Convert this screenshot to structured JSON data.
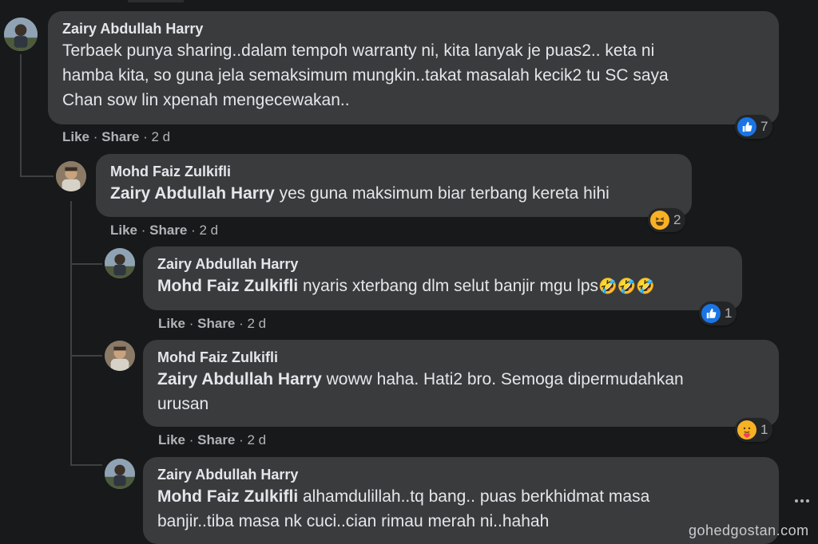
{
  "comments": [
    {
      "author": "Zairy Abdullah Harry",
      "lines": [
        "Terbaek punya sharing..dalam tempoh warranty ni, kita lanyak je puas2.. keta ni",
        "hamba kita, so guna jela semaksimum mungkin..takat masalah kecik2 tu SC saya",
        "Chan sow lin xpenah mengecewakan.."
      ],
      "like_label": "Like",
      "share_label": "Share",
      "time": "2 d",
      "reaction_type": "like",
      "reaction_count": "7"
    },
    {
      "author": "Mohd Faiz Zulkifli",
      "mention": "Zairy Abdullah Harry",
      "text": "yes guna maksimum biar terbang kereta hihi",
      "like_label": "Like",
      "share_label": "Share",
      "time": "2 d",
      "reaction_type": "haha",
      "reaction_count": "2"
    },
    {
      "author": "Zairy Abdullah Harry",
      "mention": "Mohd Faiz Zulkifli",
      "text": "nyaris xterbang dlm selut banjir mgu lps",
      "emojis": "🤣🤣🤣",
      "like_label": "Like",
      "share_label": "Share",
      "time": "2 d",
      "reaction_type": "like",
      "reaction_count": "1"
    },
    {
      "author": "Mohd Faiz Zulkifli",
      "mention": "Zairy Abdullah Harry",
      "line1": "woww haha. Hati2 bro. Semoga dipermudahkan",
      "line2": "urusan",
      "like_label": "Like",
      "share_label": "Share",
      "time": "2 d",
      "reaction_type": "care",
      "reaction_count": "1"
    },
    {
      "author": "Zairy Abdullah Harry",
      "mention": "Mohd Faiz Zulkifli",
      "line1": "alhamdulillah..tq bang.. puas berkhidmat masa",
      "line2": "banjir..tiba masa nk cuci..cian rimau merah ni..hahah"
    }
  ],
  "separator": " · ",
  "watermark": "gohedgostan.com",
  "colors": {
    "background": "#18191a",
    "bubble": "#3a3b3c",
    "text": "#e4e6eb",
    "secondary_text": "#b0b3b8",
    "like_blue": "#1b74e4",
    "haha_yellow": "#f7b125"
  },
  "icons": {
    "like": "thumbs-up-icon",
    "haha": "laughing-face-icon",
    "care": "care-face-icon",
    "more": "more-options-icon"
  }
}
